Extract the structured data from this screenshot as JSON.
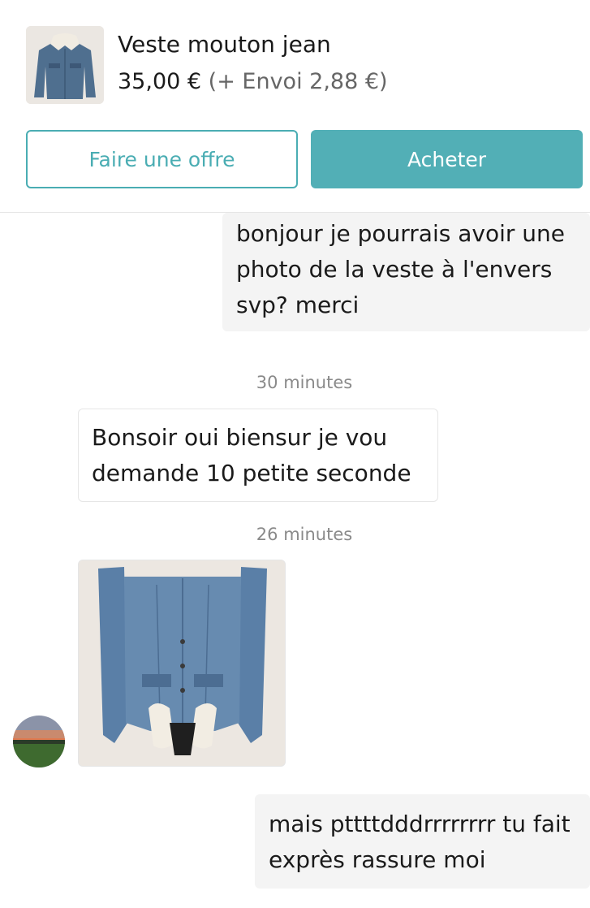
{
  "item": {
    "title": "Veste mouton jean",
    "price": "35,00 €",
    "shipping": "(+ Envoi 2,88 €)",
    "thumbnail_icon": "denim-jacket-thumbnail"
  },
  "actions": {
    "offer_label": "Faire une offre",
    "buy_label": "Acheter"
  },
  "colors": {
    "accent": "#52afb6",
    "outgoing_bubble": "#f4f4f4",
    "timestamp": "#8a8a8a"
  },
  "messages": [
    {
      "direction": "outgoing",
      "lines": [
        "bonjour je pourrais avoir une",
        "photo de la veste à l'envers",
        "svp? merci"
      ]
    },
    {
      "timestamp": "30 minutes"
    },
    {
      "direction": "incoming",
      "lines": [
        "Bonsoir oui biensur je vou",
        "demande 10 petite seconde"
      ]
    },
    {
      "timestamp": "26 minutes"
    },
    {
      "direction": "incoming",
      "type": "photo",
      "photo_icon": "denim-jacket-back-photo"
    },
    {
      "direction": "outgoing",
      "lines": [
        "mais pttttdddrrrrrrrr tu fait",
        "exprès rassure moi"
      ]
    }
  ]
}
